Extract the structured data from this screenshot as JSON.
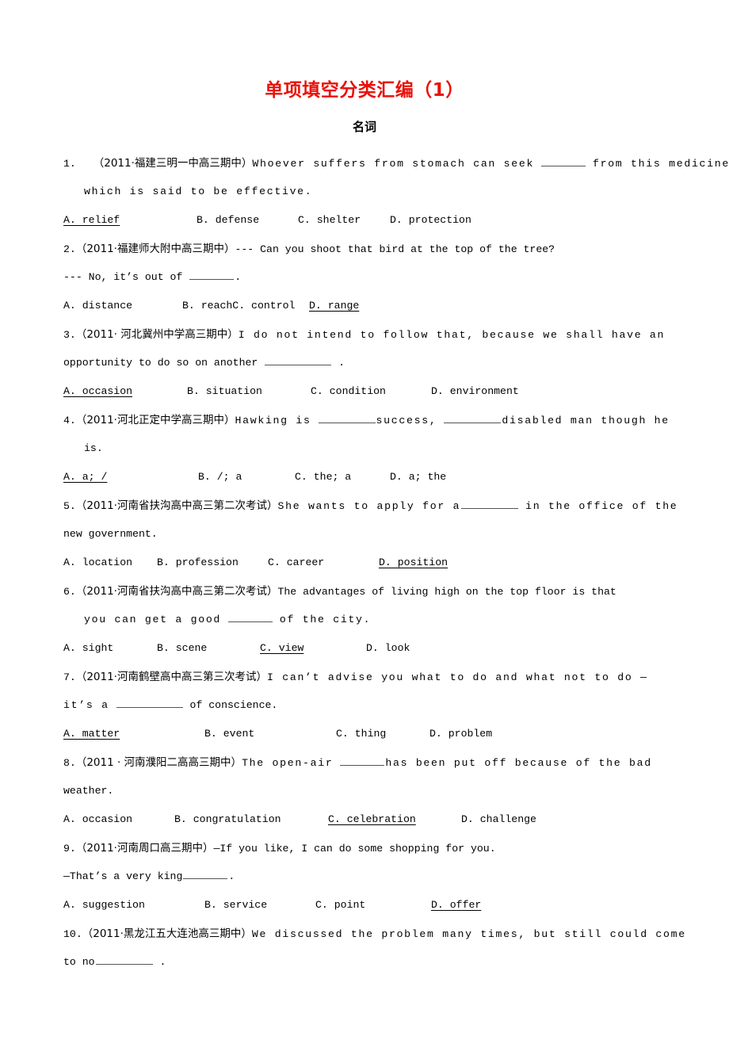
{
  "title": "单项填空分类汇编（1）",
  "subtitle": "名词",
  "questions": [
    {
      "num": "1.",
      "source": "（2011·福建三明一中高三期中）",
      "stem_a": "Whoever suffers from stomach can seek",
      "stem_b": "from this medicine,",
      "stem_line2": "which is said to be effective.",
      "options": [
        {
          "label": "A. relief",
          "correct": true
        },
        {
          "label": "B. defense",
          "correct": false
        },
        {
          "label": "C. shelter",
          "correct": false
        },
        {
          "label": "D. protection",
          "correct": false
        }
      ]
    },
    {
      "num": "2.",
      "source": "（2011·福建师大附中高三期中）",
      "stem_a": "--- Can you shoot that bird at the top of the tree?",
      "stem_b": "",
      "stem_line2_a": "--- No, it’s out of",
      "stem_line2_b": ".",
      "options": [
        {
          "label": "A. distance",
          "correct": false
        },
        {
          "label": "B. reachC. control",
          "correct": false
        },
        {
          "label": "D. range",
          "correct": true
        }
      ]
    },
    {
      "num": "3.",
      "source": "（2011· 河北冀州中学高三期中）",
      "stem_a": "I do not intend to follow that, because we shall have an",
      "stem_line2_a": "opportunity to do so on another",
      "stem_line2_b": ".",
      "options": [
        {
          "label": "A. occasion",
          "correct": true
        },
        {
          "label": "B. situation",
          "correct": false
        },
        {
          "label": "C. condition",
          "correct": false
        },
        {
          "label": "D. environment",
          "correct": false
        }
      ]
    },
    {
      "num": "4.",
      "source": "（2011·河北正定中学高三期中）",
      "stem_a": "Hawking is",
      "stem_b": "success,",
      "stem_c": "disabled man though he",
      "stem_line2": "is.",
      "options": [
        {
          "label": "A. a; /",
          "correct": true
        },
        {
          "label": "B. /; a",
          "correct": false
        },
        {
          "label": "C. the; a",
          "correct": false
        },
        {
          "label": "D. a; the",
          "correct": false
        }
      ]
    },
    {
      "num": "5.",
      "source": "（2011·河南省扶沟高中高三第二次考试）",
      "stem_a": "She wants to apply for a",
      "stem_b": "in the office of the",
      "stem_line2": "new government.",
      "options": [
        {
          "label": "A. location",
          "correct": false
        },
        {
          "label": "B. profession",
          "correct": false
        },
        {
          "label": "C. career",
          "correct": false
        },
        {
          "label": "D. position",
          "correct": true
        }
      ]
    },
    {
      "num": "6.",
      "source": "（2011·河南省扶沟高中高三第二次考试）",
      "stem_a": "The advantages of living high on the top floor is that",
      "stem_line2_a": "you can get a good",
      "stem_line2_b": "of the city.",
      "options": [
        {
          "label": "A. sight",
          "correct": false
        },
        {
          "label": "B. scene",
          "correct": false
        },
        {
          "label": "C. view",
          "correct": true
        },
        {
          "label": "D. look",
          "correct": false
        }
      ]
    },
    {
      "num": "7.",
      "source": "（2011·河南鹤壁高中高三第三次考试）",
      "stem_a": "I can’t advise you what to do and what not to do —",
      "stem_line2_a": "it’s a",
      "stem_line2_b": "of conscience.",
      "options": [
        {
          "label": "A. matter",
          "correct": true
        },
        {
          "label": "B. event",
          "correct": false
        },
        {
          "label": "C. thing",
          "correct": false
        },
        {
          "label": "D. problem",
          "correct": false
        }
      ]
    },
    {
      "num": "8.",
      "source": "（2011 · 河南濮阳二高高三期中）",
      "stem_a": "The open-air",
      "stem_b": "has been put off because of the bad",
      "stem_line2": "weather.",
      "options": [
        {
          "label": "A. occasion",
          "correct": false
        },
        {
          "label": "B. congratulation",
          "correct": false
        },
        {
          "label": "C. celebration",
          "correct": true
        },
        {
          "label": "D. challenge",
          "correct": false
        }
      ]
    },
    {
      "num": "9.",
      "source": "（2011·河南周口高三期中）",
      "stem_a": "—If you like, I can do some shopping for you.",
      "stem_line2_a": "—That’s a very king",
      "stem_line2_b": ".",
      "options": [
        {
          "label": "A. suggestion",
          "correct": false
        },
        {
          "label": "B. service",
          "correct": false
        },
        {
          "label": "C. point",
          "correct": false
        },
        {
          "label": "D. offer",
          "correct": true
        }
      ]
    },
    {
      "num": "10.",
      "source": "（2011·黑龙江五大连池高三期中）",
      "stem_a": "We discussed the problem many times, but still could come",
      "stem_line2_a": "to no",
      "stem_line2_b": ".",
      "options": []
    }
  ]
}
